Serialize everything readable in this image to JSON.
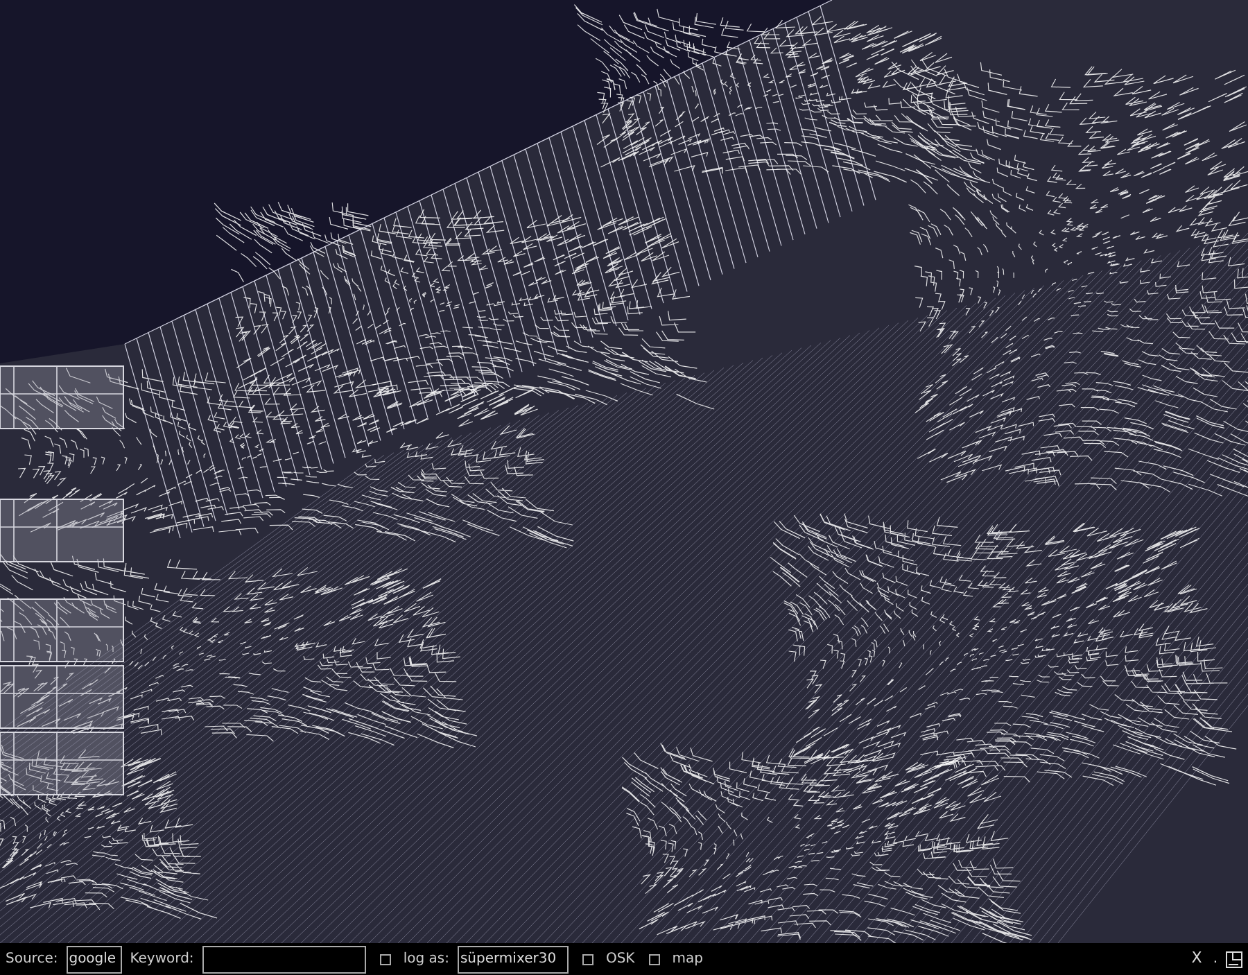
{
  "toolbar": {
    "source": {
      "label": "Source:",
      "value": "google"
    },
    "keyword": {
      "label": "Keyword:"
    },
    "log_as": {
      "label": "log as:",
      "checked": false,
      "value": "süpermixer30"
    },
    "options": [
      {
        "label": "OSK",
        "checked": false
      },
      {
        "label": "map",
        "checked": false
      }
    ],
    "close": "X",
    "dot": "."
  }
}
